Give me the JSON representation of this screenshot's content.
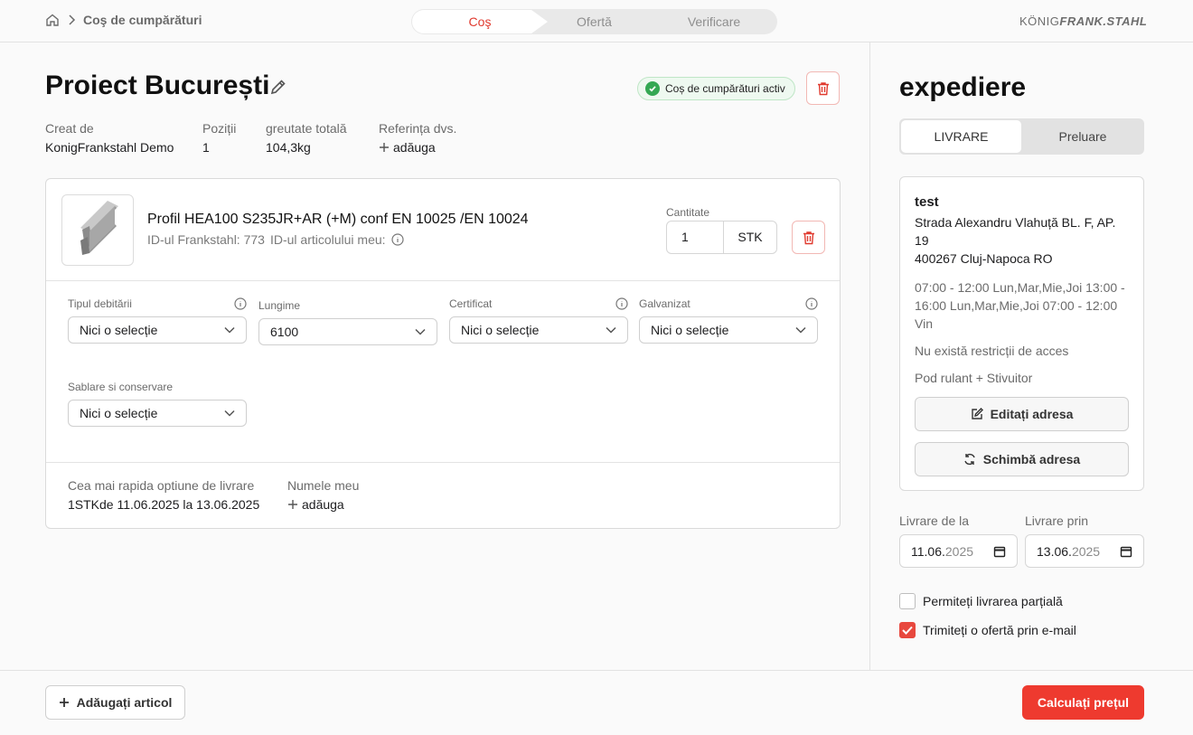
{
  "header": {
    "breadcrumb": "Coş de cumpărături",
    "steps": [
      "Coş",
      "Ofertă",
      "Verificare"
    ],
    "logo_left": "KÖNIG",
    "logo_right": "FRANK.STAHL"
  },
  "project": {
    "title": "Proiect București",
    "status_badge": "Coș de cumpărături activ",
    "meta": [
      {
        "label": "Creat de",
        "value": "KonigFrankstahl Demo"
      },
      {
        "label": "Poziții",
        "value": "1"
      },
      {
        "label": "greutate totală",
        "value": "104,3kg"
      },
      {
        "label": "Referința dvs.",
        "value": "adăuga"
      }
    ]
  },
  "item": {
    "name": "Profil HEA100 S235JR+AR (+M) conf EN 10025 /EN 10024",
    "id_text": "ID-ul Frankstahl: 773",
    "my_id_label": "ID-ul articolului meu:",
    "quantity_label": "Cantitate",
    "quantity": "1",
    "unit": "STK",
    "options": [
      {
        "label": "Tipul debitării",
        "value": "Nici o selecție",
        "has_info": true
      },
      {
        "label": "Lungime",
        "value": "6100",
        "has_info": false
      },
      {
        "label": "Certificat",
        "value": "Nici o selecție",
        "has_info": true
      },
      {
        "label": "Galvanizat",
        "value": "Nici o selecție",
        "has_info": true
      },
      {
        "label": "Sablare si conservare",
        "value": "Nici o selecție",
        "has_info": false
      }
    ],
    "delivery_label": "Cea mai rapida optiune de livrare",
    "delivery_value": "1STKde 11.06.2025 la 13.06.2025",
    "my_name_label": "Numele meu",
    "my_name_add": "adăuga"
  },
  "footer": {
    "add_article": "Adăugați articol",
    "calculate": "Calculați prețul"
  },
  "shipping": {
    "title": "expediere",
    "tab_delivery": "LIVRARE",
    "tab_pickup": "Preluare",
    "address_name": "test",
    "address_street": "Strada Alexandru Vlahuță BL. F, AP. 19",
    "address_city": "400267 Cluj-Napoca RO",
    "hours": "07:00 - 12:00 Lun,Mar,Mie,Joi 13:00 - 16:00 Lun,Mar,Mie,Joi 07:00 - 12:00 Vin",
    "access": "Nu există restricții de acces",
    "equipment": "Pod rulant + Stivuitor",
    "edit_button": "Editați adresa",
    "change_button": "Schimbă adresa",
    "date_from_label": "Livrare de la",
    "date_from_dm": "11.06.",
    "date_from_y": "2025",
    "date_to_label": "Livrare prin",
    "date_to_dm": "13.06.",
    "date_to_y": "2025",
    "partial_label": "Permiteți livrarea parțială",
    "partial_checked": false,
    "email_label": "Trimiteți o ofertă prin e-mail",
    "email_checked": true
  },
  "colors": {
    "accent": "#ee3a2f",
    "success": "#34a853"
  }
}
